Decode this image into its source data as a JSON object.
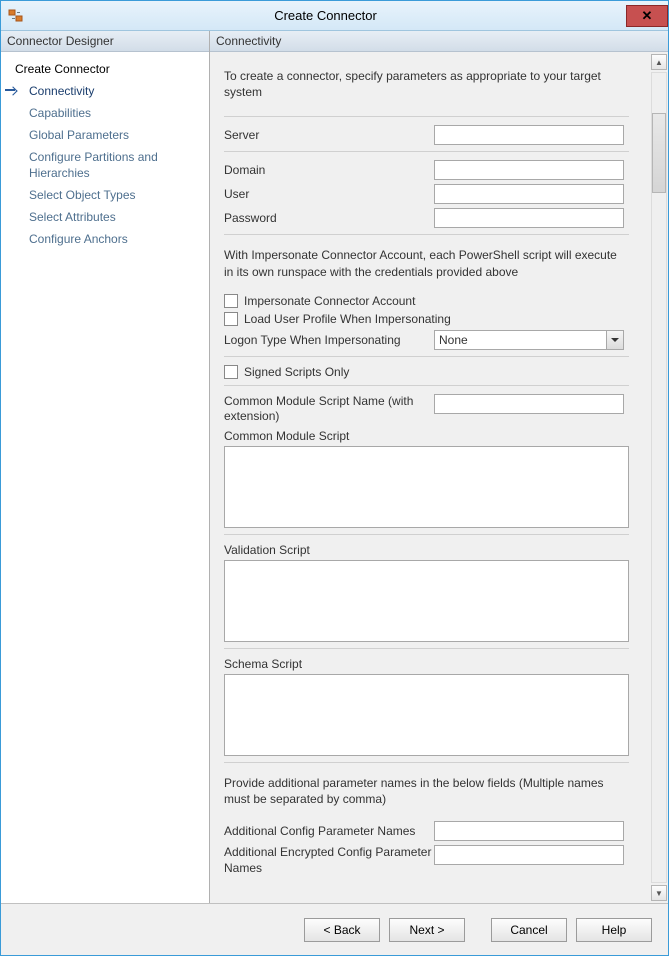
{
  "window": {
    "title": "Create Connector"
  },
  "sidebar": {
    "header": "Connector Designer",
    "items": [
      {
        "label": "Create Connector"
      },
      {
        "label": "Connectivity"
      },
      {
        "label": "Capabilities"
      },
      {
        "label": "Global Parameters"
      },
      {
        "label": "Configure Partitions and Hierarchies"
      },
      {
        "label": "Select Object Types"
      },
      {
        "label": "Select Attributes"
      },
      {
        "label": "Configure Anchors"
      }
    ]
  },
  "content": {
    "header": "Connectivity",
    "intro": "To create a connector, specify parameters as appropriate to your target system",
    "server_label": "Server",
    "domain_label": "Domain",
    "user_label": "User",
    "password_label": "Password",
    "impersonate_desc": "With Impersonate Connector Account, each PowerShell script will execute in its own runspace with the credentials provided above",
    "impersonate_check": "Impersonate Connector Account",
    "loadprofile_check": "Load User Profile When Impersonating",
    "logontype_label": "Logon Type When Impersonating",
    "logontype_value": "None",
    "signed_check": "Signed Scripts Only",
    "common_name_label": "Common Module Script Name (with extension)",
    "common_script_label": "Common Module Script",
    "validation_label": "Validation Script",
    "schema_label": "Schema Script",
    "additional_desc": "Provide additional parameter names in the below fields (Multiple names must be separated by comma)",
    "addl_config_label": "Additional Config Parameter Names",
    "addl_encrypted_label": "Additional Encrypted Config Parameter Names"
  },
  "footer": {
    "back": "<  Back",
    "next": "Next  >",
    "cancel": "Cancel",
    "help": "Help"
  }
}
